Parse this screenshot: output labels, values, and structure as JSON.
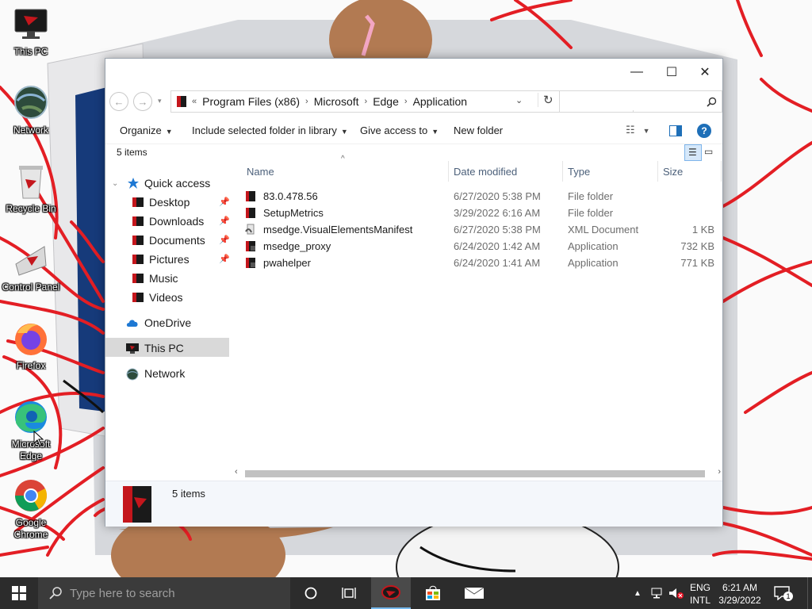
{
  "desktop": {
    "icons": [
      {
        "label": "This PC"
      },
      {
        "label": "Network"
      },
      {
        "label": "Recycle Bin"
      },
      {
        "label": "Control Panel"
      },
      {
        "label": "Firefox"
      },
      {
        "label": "Microsoft Edge"
      },
      {
        "label": "Google Chrome"
      }
    ]
  },
  "window": {
    "controls": {
      "minimize": "—",
      "maximize": "☐",
      "close": "✕"
    },
    "address": {
      "overflow": "«",
      "crumbs": [
        "Program Files (x86)",
        "Microsoft",
        "Edge",
        "Application"
      ]
    },
    "search": {
      "placeholder": ""
    },
    "toolbar": {
      "organize": "Organize",
      "include": "Include selected folder in library",
      "share": "Give access to",
      "new_folder": "New folder"
    },
    "item_count": "5 items",
    "nav": {
      "quick_access": "Quick access",
      "quick_items": [
        "Desktop",
        "Downloads",
        "Documents",
        "Pictures",
        "Music",
        "Videos"
      ],
      "onedrive": "OneDrive",
      "this_pc": "This PC",
      "network": "Network"
    },
    "columns": {
      "name": "Name",
      "date": "Date modified",
      "type": "Type",
      "size": "Size"
    },
    "files": [
      {
        "name": "83.0.478.56",
        "date": "6/27/2020 5:38 PM",
        "type": "File folder",
        "size": ""
      },
      {
        "name": "SetupMetrics",
        "date": "3/29/2022 6:16 AM",
        "type": "File folder",
        "size": ""
      },
      {
        "name": "msedge.VisualElementsManifest",
        "date": "6/27/2020 5:38 PM",
        "type": "XML Document",
        "size": "1 KB"
      },
      {
        "name": "msedge_proxy",
        "date": "6/24/2020 1:42 AM",
        "type": "Application",
        "size": "732 KB"
      },
      {
        "name": "pwahelper",
        "date": "6/24/2020 1:41 AM",
        "type": "Application",
        "size": "771 KB"
      }
    ],
    "details_count": "5 items"
  },
  "taskbar": {
    "search_placeholder": "Type here to search",
    "lang": "ENG",
    "layout": "INTL",
    "time": "6:21 AM",
    "date": "3/29/2022",
    "notification_count": "1"
  },
  "colors": {
    "accent": "#0078d7",
    "selected_nav": "#d9d9d9",
    "taskbar": "#2c2c2c"
  }
}
